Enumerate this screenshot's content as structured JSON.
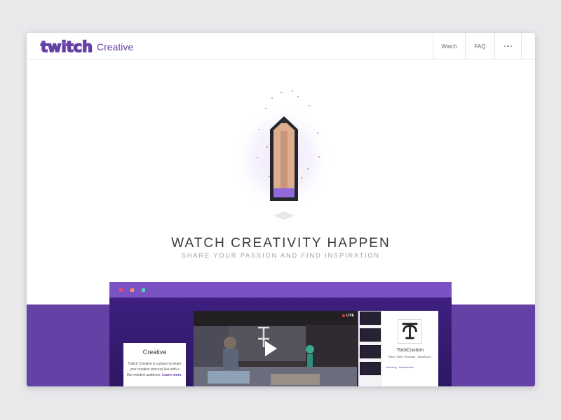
{
  "header": {
    "logo_text": "twitch",
    "subtitle": "Creative",
    "nav": {
      "watch": "Watch",
      "faq": "FAQ",
      "more_icon": "more-dots-icon"
    }
  },
  "hero": {
    "illustration_icon": "pencil-icon",
    "headline": "WATCH CREATIVITY HAPPEN",
    "subheadline": "SHARE YOUR PASSION AND FIND INSPIRATION"
  },
  "screenshot": {
    "live_label": "LIVE",
    "play_icon": "play-icon",
    "channel_name": "TockCustom",
    "channel_description": "Tinker Tailor Thursday - Allowing it...",
    "tags": "#sewing  #milwaukee",
    "card": {
      "title": "Creative",
      "text": "Twitch Creative is a place to share your creative process live with a like-minded audience.",
      "link": "Learn more."
    }
  },
  "colors": {
    "brand_purple": "#6441a5",
    "bar_purple": "#7b52c4",
    "dot_red": "#e8476b",
    "dot_orange": "#f29b4c",
    "dot_teal": "#55d2b9"
  }
}
